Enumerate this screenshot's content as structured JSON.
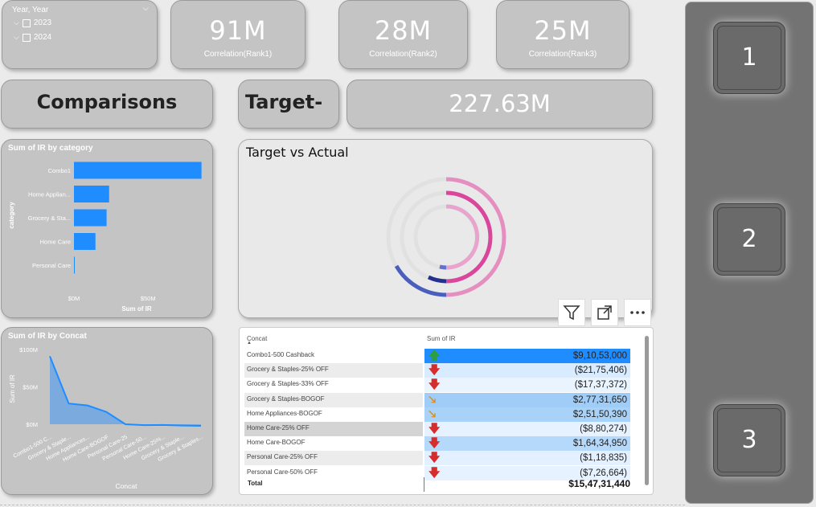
{
  "slicer": {
    "title": "Year, Year",
    "items": [
      "2023",
      "2024"
    ]
  },
  "kpis": [
    {
      "value": "91M",
      "label": "Correlation(Rank1)"
    },
    {
      "value": "28M",
      "label": "Correlation(Rank2)"
    },
    {
      "value": "25M",
      "label": "Correlation(Rank3)"
    }
  ],
  "comparisons_label": "Comparisons",
  "target_label": "Target-",
  "target_value": "227.63M",
  "nav_buttons": [
    "1",
    "2",
    "3"
  ],
  "chart_data": [
    {
      "type": "bar",
      "title": "Sum of IR by category",
      "ylabel": "category",
      "xlabel": "Sum of IR",
      "x_ticks": [
        "$0M",
        "$50M"
      ],
      "xlim": [
        0,
        90
      ],
      "categories": [
        "Combo1",
        "Home Applian...",
        "Grocery & Sta...",
        "Home Care",
        "Personal Care"
      ],
      "values": [
        86,
        23.7,
        22,
        14.5,
        0.3
      ],
      "color": "#1f8cff"
    },
    {
      "type": "area",
      "title": "Sum of IR by Concat",
      "ylabel": "Sum of IR",
      "xlabel": "Concat",
      "y_ticks": [
        "$100M",
        "$50M",
        "$0M"
      ],
      "ylim": [
        0,
        100
      ],
      "categories": [
        "Combo1-500 C...",
        "Grocery & Staple...",
        "Home Appliances...",
        "Home Care-BOGOF",
        "Personal Care-25",
        "Personal Care-50...",
        "Home Care-25%...",
        "Grocery & Staple...",
        "Grocery & Staples..."
      ],
      "values": [
        91,
        27.7,
        25.1,
        16.4,
        0,
        -1.2,
        -0.9,
        -1.7,
        -2.2
      ],
      "color": "#1f8cff"
    },
    {
      "type": "radial_bar",
      "title": "Target vs Actual"
    }
  ],
  "table": {
    "headers": [
      "Concat",
      "Sum of IR"
    ],
    "rows": [
      {
        "name": "Combo1-500 Cashback",
        "value": "$9,10,53,000",
        "arrow": "up"
      },
      {
        "name": "Grocery & Staples-25% OFF",
        "value": "($21,75,406)",
        "arrow": "down"
      },
      {
        "name": "Grocery & Staples-33% OFF",
        "value": "($17,37,372)",
        "arrow": "down"
      },
      {
        "name": "Grocery & Staples-BOGOF",
        "value": "$2,77,31,650",
        "arrow": "diag"
      },
      {
        "name": "Home Appliances-BOGOF",
        "value": "$2,51,50,390",
        "arrow": "diag"
      },
      {
        "name": "Home Care-25% OFF",
        "value": "($8,80,274)",
        "arrow": "down"
      },
      {
        "name": "Home Care-BOGOF",
        "value": "$1,64,34,950",
        "arrow": "down"
      },
      {
        "name": "Personal Care-25% OFF",
        "value": "($1,18,835)",
        "arrow": "down"
      },
      {
        "name": "Personal Care-50% OFF",
        "value": "($7,26,664)",
        "arrow": "down"
      }
    ],
    "total_label": "Total",
    "total_value": "$15,47,31,440"
  },
  "colors": {
    "accent": "#1f8cff",
    "up_arrow": "#2e9e3e",
    "down_arrow": "#d62c2c",
    "diag_arrow": "#d98d1d"
  }
}
